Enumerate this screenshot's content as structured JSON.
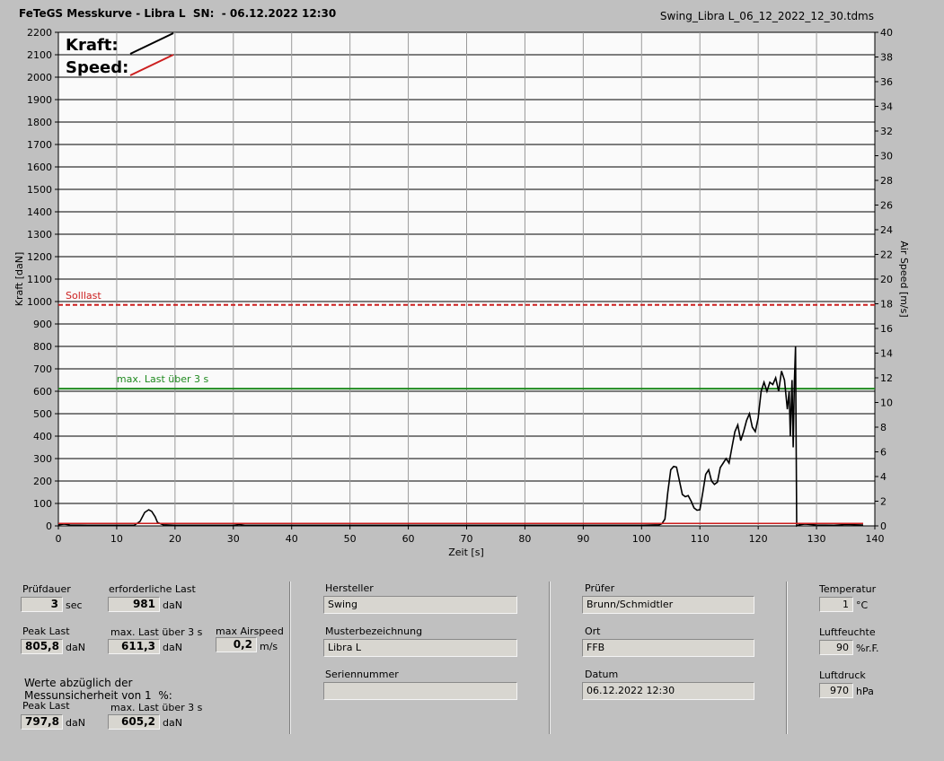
{
  "header": {
    "title": "FeTeGS Messkurve - Libra L  SN:  - 06.12.2022 12:30",
    "filename": "Swing_Libra L_06_12_2022_12_30.tdms"
  },
  "chart_data": {
    "type": "line",
    "xlabel": "Zeit [s]",
    "ylabel": "Kraft [daN]",
    "y2label": "Air Speed [m/s]",
    "xlim": [
      0,
      140
    ],
    "ylim": [
      0,
      2200
    ],
    "y2lim": [
      0,
      40
    ],
    "x_ticks": [
      0,
      10,
      20,
      30,
      40,
      50,
      60,
      70,
      80,
      90,
      100,
      110,
      120,
      130,
      140
    ],
    "y_ticks": [
      0,
      100,
      200,
      300,
      400,
      500,
      600,
      700,
      800,
      900,
      1000,
      1100,
      1200,
      1300,
      1400,
      1500,
      1600,
      1700,
      1800,
      1900,
      2000,
      2100,
      2200
    ],
    "y2_ticks": [
      0,
      2,
      4,
      6,
      8,
      10,
      12,
      14,
      16,
      18,
      20,
      22,
      24,
      26,
      28,
      30,
      32,
      34,
      36,
      38,
      40
    ],
    "grid": true,
    "legend": {
      "position": "top-left",
      "entries": [
        "Kraft:",
        "Speed:"
      ]
    },
    "colors": {
      "kraft": "#000000",
      "speed": "#cc1f1f",
      "solllast": "#cc1f1f",
      "maxlast": "#1f8a1f"
    },
    "annotations": [
      {
        "label": "Solllast",
        "y": 985,
        "style": "dashed"
      },
      {
        "label": "max. Last über  3 s",
        "y": 611.3,
        "style": "solid"
      }
    ],
    "series": [
      {
        "name": "Kraft:",
        "points": [
          [
            0,
            5
          ],
          [
            1,
            8
          ],
          [
            2,
            4
          ],
          [
            5,
            3
          ],
          [
            10,
            3
          ],
          [
            13,
            3
          ],
          [
            14,
            20
          ],
          [
            14.8,
            60
          ],
          [
            15.5,
            72
          ],
          [
            16,
            65
          ],
          [
            16.6,
            40
          ],
          [
            17,
            15
          ],
          [
            18,
            5
          ],
          [
            20,
            3
          ],
          [
            30,
            3
          ],
          [
            31,
            6
          ],
          [
            32,
            3
          ],
          [
            60,
            3
          ],
          [
            100,
            3
          ],
          [
            103,
            5
          ],
          [
            103.5,
            10
          ],
          [
            104,
            30
          ],
          [
            104.5,
            150
          ],
          [
            105,
            250
          ],
          [
            105.5,
            265
          ],
          [
            106,
            262
          ],
          [
            106.5,
            200
          ],
          [
            107,
            140
          ],
          [
            107.5,
            130
          ],
          [
            108,
            135
          ],
          [
            108.5,
            110
          ],
          [
            109,
            80
          ],
          [
            109.5,
            70
          ],
          [
            110,
            72
          ],
          [
            110.5,
            150
          ],
          [
            111,
            230
          ],
          [
            111.5,
            250
          ],
          [
            112,
            200
          ],
          [
            112.5,
            185
          ],
          [
            113,
            195
          ],
          [
            113.5,
            260
          ],
          [
            114,
            280
          ],
          [
            114.5,
            300
          ],
          [
            115,
            280
          ],
          [
            115.5,
            350
          ],
          [
            116,
            420
          ],
          [
            116.5,
            450
          ],
          [
            117,
            380
          ],
          [
            117.5,
            420
          ],
          [
            118,
            470
          ],
          [
            118.5,
            500
          ],
          [
            119,
            440
          ],
          [
            119.5,
            420
          ],
          [
            120,
            480
          ],
          [
            120.5,
            600
          ],
          [
            121,
            640
          ],
          [
            121.5,
            600
          ],
          [
            122,
            640
          ],
          [
            122.5,
            630
          ],
          [
            123,
            660
          ],
          [
            123.5,
            600
          ],
          [
            124,
            690
          ],
          [
            124.5,
            650
          ],
          [
            125,
            520
          ],
          [
            125.3,
            600
          ],
          [
            125.5,
            400
          ],
          [
            125.8,
            650
          ],
          [
            126,
            350
          ],
          [
            126.2,
            640
          ],
          [
            126.4,
            800
          ],
          [
            126.6,
            0
          ],
          [
            127,
            5
          ],
          [
            128,
            8
          ],
          [
            130,
            4
          ],
          [
            133,
            3
          ],
          [
            135,
            6
          ],
          [
            138,
            4
          ]
        ]
      },
      {
        "name": "Speed:",
        "points": [
          [
            0,
            0.2
          ],
          [
            138,
            0.2
          ]
        ]
      }
    ]
  },
  "panel": {
    "pruefdauer": {
      "label": "Prüfdauer",
      "value": "3",
      "unit": "sec"
    },
    "erf_last": {
      "label": "erforderliche Last",
      "value": "981",
      "unit": "daN"
    },
    "peak_last": {
      "label": "Peak Last",
      "value": "805,8",
      "unit": "daN"
    },
    "max_last": {
      "label": "max. Last über  3 s",
      "value": "611,3",
      "unit": "daN"
    },
    "max_airspeed": {
      "label": "max Airspeed",
      "value": "0,2",
      "unit": "m/s"
    },
    "werte_note": "Werte abzüglich der\nMessunsicherheit von 1  %:",
    "peak_last2": {
      "label": "Peak Last",
      "value": "797,8",
      "unit": "daN"
    },
    "max_last2": {
      "label": "max. Last über  3 s",
      "value": "605,2",
      "unit": "daN"
    },
    "hersteller": {
      "label": "Hersteller",
      "value": "Swing"
    },
    "muster": {
      "label": "Musterbezeichnung",
      "value": "Libra L"
    },
    "serien": {
      "label": "Seriennummer",
      "value": ""
    },
    "pruefer": {
      "label": "Prüfer",
      "value": "Brunn/Schmidtler"
    },
    "ort": {
      "label": "Ort",
      "value": "FFB"
    },
    "datum": {
      "label": "Datum",
      "value": "06.12.2022 12:30"
    },
    "temperatur": {
      "label": "Temperatur",
      "value": "1",
      "unit": "°C"
    },
    "luftfeuchte": {
      "label": "Luftfeuchte",
      "value": "90",
      "unit": "%r.F."
    },
    "luftdruck": {
      "label": "Luftdruck",
      "value": "970",
      "unit": "hPa"
    }
  }
}
